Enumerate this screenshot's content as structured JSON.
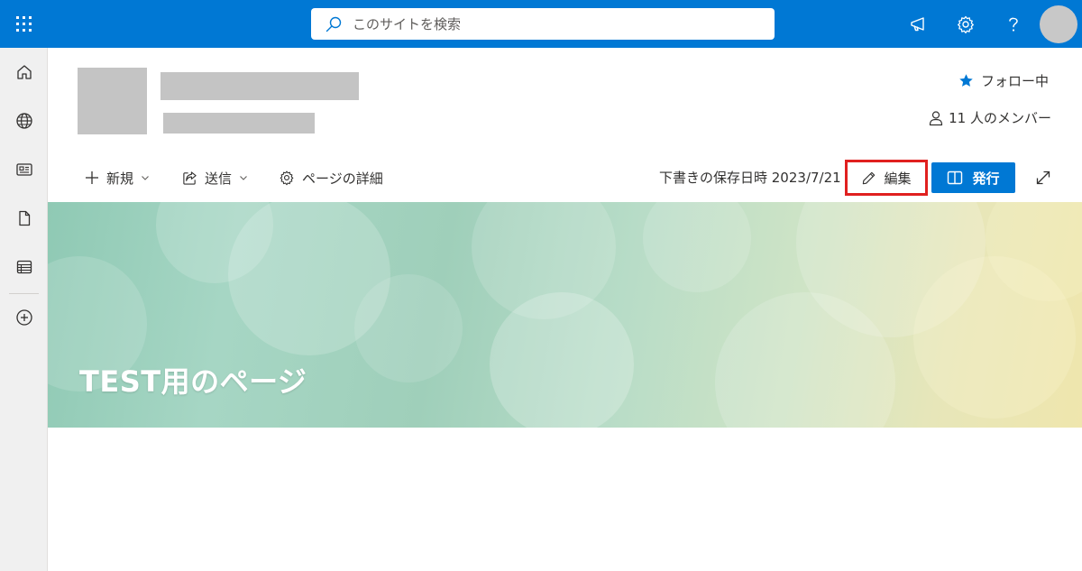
{
  "search": {
    "placeholder": "このサイトを検索"
  },
  "header": {
    "follow_label": "フォロー中",
    "members_label": "11 人のメンバー"
  },
  "toolbar": {
    "new_label": "新規",
    "send_label": "送信",
    "page_details_label": "ページの詳細",
    "saved_status": "下書きの保存日時 2023/7/21",
    "edit_label": "編集",
    "publish_label": "発行"
  },
  "hero": {
    "title": "TEST用のページ"
  },
  "colors": {
    "brand": "#0078d4",
    "highlight_border": "#e0201f"
  },
  "icons": [
    "app-launcher-icon",
    "search-icon",
    "megaphone-icon",
    "gear-icon",
    "help-icon",
    "home-icon",
    "globe-icon",
    "news-icon",
    "file-icon",
    "list-icon",
    "add-circle-icon",
    "star-icon",
    "person-icon",
    "plus-icon",
    "share-icon",
    "pencil-icon",
    "book-icon",
    "expand-icon"
  ]
}
